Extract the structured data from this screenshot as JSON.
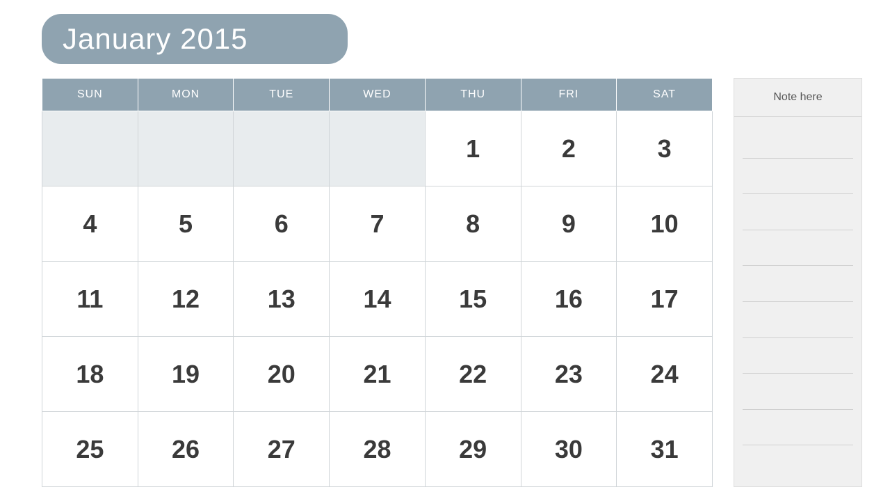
{
  "header": {
    "title": "January 2015"
  },
  "calendar": {
    "days_of_week": [
      "SUN",
      "MON",
      "TUE",
      "WED",
      "THU",
      "FRI",
      "SAT"
    ],
    "weeks": [
      [
        null,
        null,
        null,
        null,
        "1",
        "2",
        "3"
      ],
      [
        "4",
        "5",
        "6",
        "7",
        "8",
        "9",
        "10"
      ],
      [
        "11",
        "12",
        "13",
        "14",
        "15",
        "16",
        "17"
      ],
      [
        "18",
        "19",
        "20",
        "21",
        "22",
        "23",
        "24"
      ],
      [
        "25",
        "26",
        "27",
        "28",
        "29",
        "30",
        "31"
      ]
    ]
  },
  "notes": {
    "header": "Note here",
    "line_count": 10
  }
}
